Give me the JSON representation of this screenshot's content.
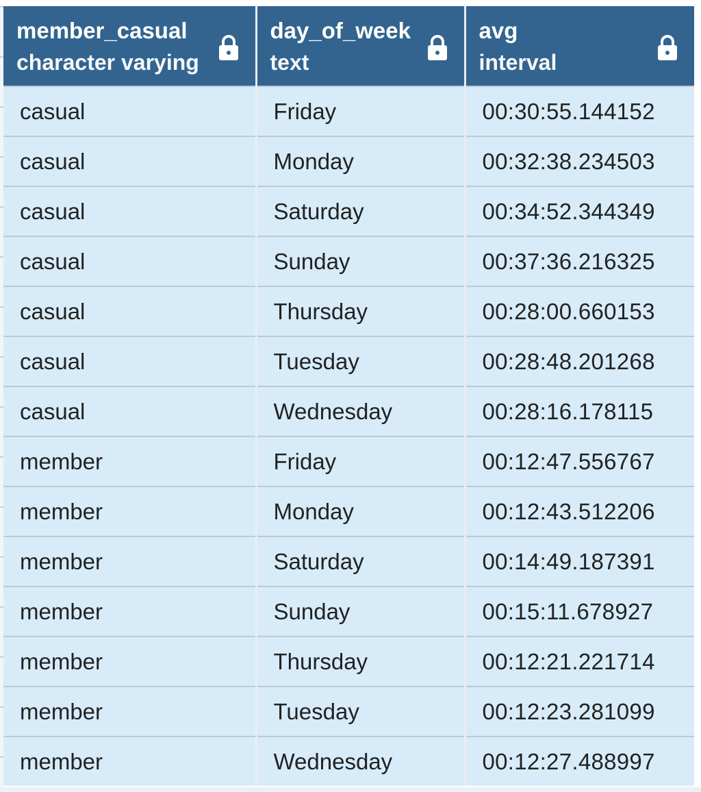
{
  "columns": [
    {
      "name": "member_casual",
      "type": "character varying",
      "icon": "lock-icon"
    },
    {
      "name": "day_of_week",
      "type": "text",
      "icon": "lock-icon"
    },
    {
      "name": "avg",
      "type": "interval",
      "icon": "lock-icon"
    }
  ],
  "rows": [
    [
      "casual",
      "Friday",
      "00:30:55.144152"
    ],
    [
      "casual",
      "Monday",
      "00:32:38.234503"
    ],
    [
      "casual",
      "Saturday",
      "00:34:52.344349"
    ],
    [
      "casual",
      "Sunday",
      "00:37:36.216325"
    ],
    [
      "casual",
      "Thursday",
      "00:28:00.660153"
    ],
    [
      "casual",
      "Tuesday",
      "00:28:48.201268"
    ],
    [
      "casual",
      "Wednesday",
      "00:28:16.178115"
    ],
    [
      "member",
      "Friday",
      "00:12:47.556767"
    ],
    [
      "member",
      "Monday",
      "00:12:43.512206"
    ],
    [
      "member",
      "Saturday",
      "00:14:49.187391"
    ],
    [
      "member",
      "Sunday",
      "00:15:11.678927"
    ],
    [
      "member",
      "Thursday",
      "00:12:21.221714"
    ],
    [
      "member",
      "Tuesday",
      "00:12:23.281099"
    ],
    [
      "member",
      "Wednesday",
      "00:12:27.488997"
    ]
  ],
  "colors": {
    "header_bg": "#33648f",
    "cell_bg": "#d7ecf8",
    "header_text": "#ffffff"
  }
}
